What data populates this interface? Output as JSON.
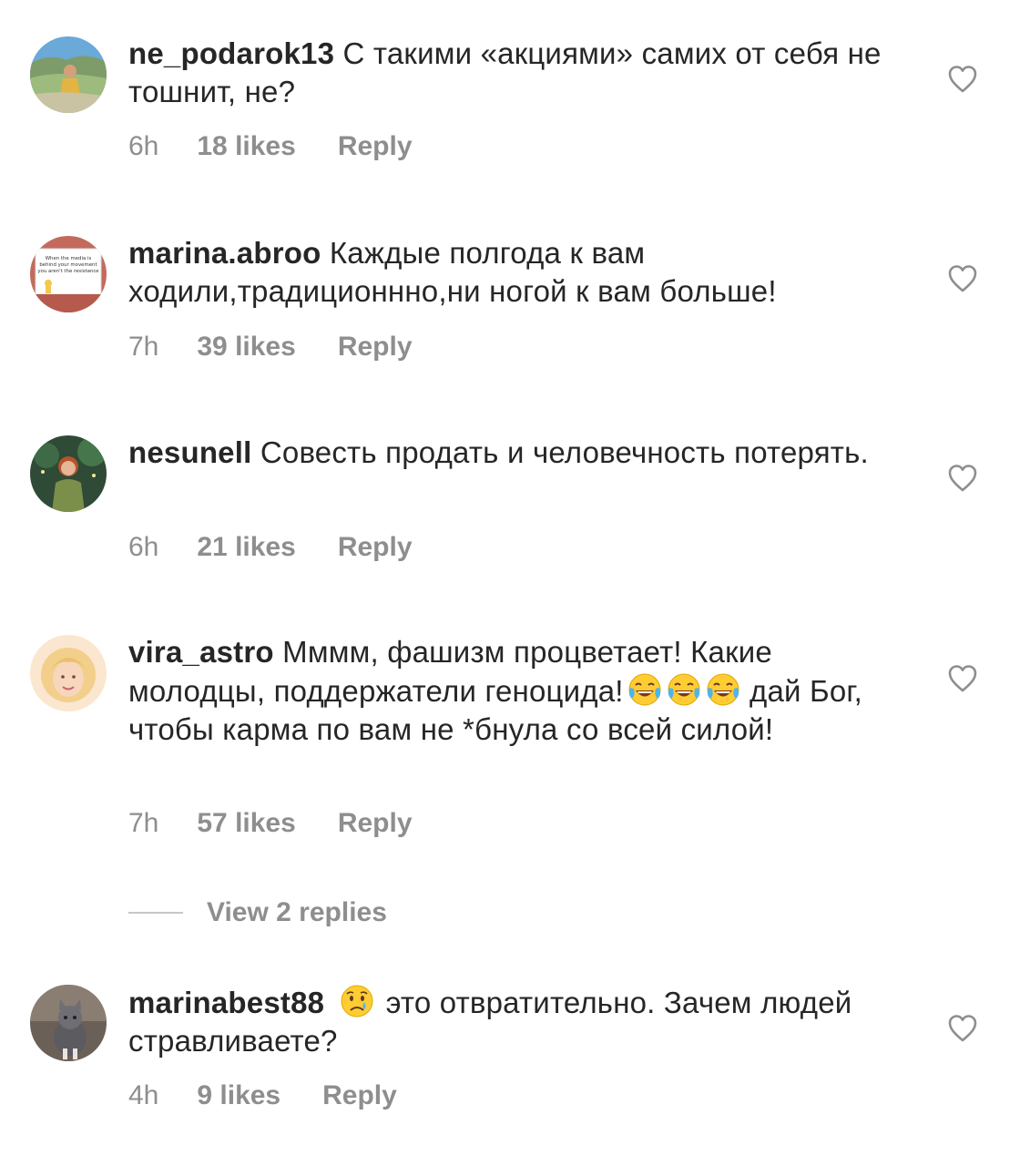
{
  "comments": [
    {
      "username": "ne_podarok13",
      "text": "С такими «акциями» самих от себя не тошнит, не?",
      "time": "6h",
      "likes": "18 likes",
      "reply": "Reply"
    },
    {
      "username": "marina.abroo",
      "text": "Каждые полгода к вам ходили,традиционнно,ни ногой к вам больше!",
      "time": "7h",
      "likes": "39 likes",
      "reply": "Reply",
      "avatar_text": [
        "When the media is",
        "behind your movement",
        "you aren't the resistance"
      ]
    },
    {
      "username": "nesunell",
      "text": "Совесть продать и человечность потерять.",
      "time": "6h",
      "likes": "21 likes",
      "reply": "Reply"
    },
    {
      "username": "vira_astro",
      "text_before_emoji": "Мммм, фашизм процветает! Какие молодцы, поддержатели геноцида!",
      "emoji": [
        "face-with-tears-of-joy-icon",
        "face-with-tears-of-joy-icon",
        "face-with-tears-of-joy-icon"
      ],
      "text_after_emoji": "дай Бог, чтобы карма по вам не *бнула со всей силой!",
      "time": "7h",
      "likes": "57 likes",
      "reply": "Reply"
    },
    {
      "username": "marinabest88",
      "emoji": [
        "crying-face-icon"
      ],
      "text": "это отвратительно. Зачем людей стравливаете?",
      "time": "4h",
      "likes": "9 likes",
      "reply": "Reply"
    }
  ],
  "view_replies": "View 2 replies",
  "colors": {
    "text": "#262626",
    "secondary": "#8e8e8e",
    "divider": "#c7c7c7",
    "heart_outline": "#8e8e8e"
  }
}
